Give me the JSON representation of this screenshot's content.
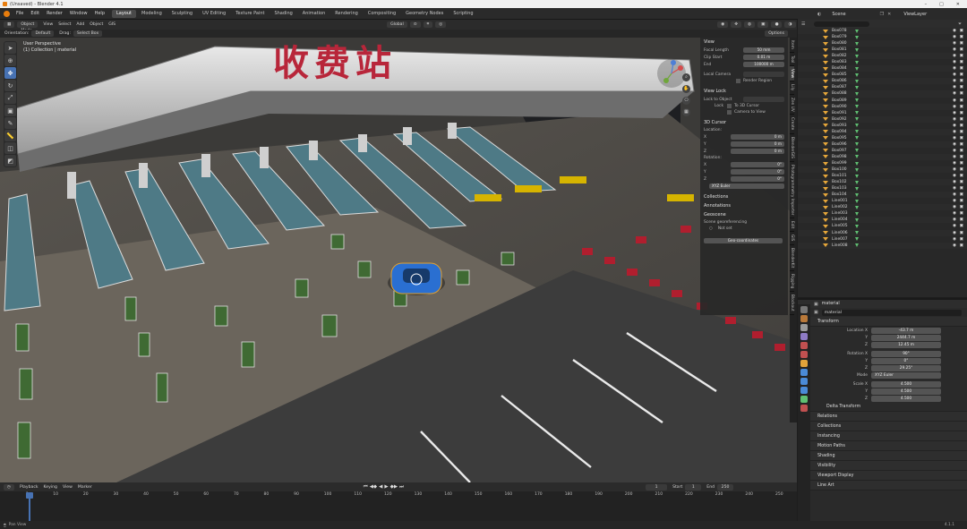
{
  "window": {
    "title": "(Unsaved) - Blender 4.1",
    "controls": [
      "–",
      "□",
      "✕"
    ]
  },
  "menubar": {
    "items": [
      "File",
      "Edit",
      "Render",
      "Window",
      "Help"
    ],
    "workspaces": [
      "Layout",
      "Modeling",
      "Sculpting",
      "UV Editing",
      "Texture Paint",
      "Shading",
      "Animation",
      "Rendering",
      "Compositing",
      "Geometry Nodes",
      "Scripting"
    ],
    "active_workspace": "Layout",
    "scene_label": "Scene",
    "viewlayer_label": "ViewLayer"
  },
  "viewport_header": {
    "mode": "Object Mode",
    "menus": [
      "View",
      "Select",
      "Add",
      "Object",
      "GIS"
    ],
    "transform": "Global",
    "options": "Options",
    "orientation_label": "Orientation:",
    "orientation_value": "Default",
    "drag_label": "Drag:",
    "drag_value": "Select Box"
  },
  "viewport": {
    "perspective": "User Perspective",
    "collection": "(1) Collection | material",
    "sign_text": "收费站"
  },
  "npanel": {
    "view_title": "View",
    "focal_length_label": "Focal Length",
    "focal_length": "50 mm",
    "clip_start_label": "Clip Start",
    "clip_start": "0.01 m",
    "clip_end_label": "End",
    "clip_end": "100000 m",
    "local_camera_label": "Local Camera",
    "render_region_label": "Render Region",
    "view_lock_title": "View Lock",
    "lock_to_object_label": "Lock to Object",
    "lock_label": "Lock",
    "to_3d_cursor_label": "To 3D Cursor",
    "camera_to_view_label": "Camera to View",
    "cursor_title": "3D Cursor",
    "location_label": "Location:",
    "rotation_label": "Rotation:",
    "axes": [
      "X",
      "Y",
      "Z"
    ],
    "loc_values": [
      "0 m",
      "0 m",
      "0 m"
    ],
    "rot_values": [
      "0°",
      "0°",
      "0°"
    ],
    "rotation_mode": "XYZ Euler",
    "collections_title": "Collections",
    "annotations_title": "Annotations",
    "georef_title": "Geoscene",
    "georef_label": "Scene georeferencing",
    "georef_crs": "Not set",
    "geo_coords_btn": "Geo-coordinates",
    "tabs": [
      "Item",
      "Tool",
      "View",
      "Lily",
      "Zen UV",
      "Create",
      "BlenderGIS",
      "Photogrammetry Importer",
      "Edit",
      "GIS",
      "BlenderKit",
      "Rigging",
      "Blockout"
    ]
  },
  "outliner": {
    "search_placeholder": "",
    "items": [
      "Box078",
      "Box079",
      "Box080",
      "Box081",
      "Box082",
      "Box083",
      "Box084",
      "Box085",
      "Box086",
      "Box087",
      "Box088",
      "Box089",
      "Box090",
      "Box091",
      "Box092",
      "Box093",
      "Box094",
      "Box095",
      "Box096",
      "Box097",
      "Box098",
      "Box099",
      "Box100",
      "Box101",
      "Box102",
      "Box103",
      "Box104",
      "Line001",
      "Line002",
      "Line003",
      "Line004",
      "Line005",
      "Line006",
      "Line007",
      "Line008"
    ]
  },
  "properties": {
    "object_name": "material",
    "data_name": "material",
    "transform_title": "Transform",
    "location_label": "Location X",
    "location": [
      "-43.7 m",
      "2444.7 m",
      "12.45 m"
    ],
    "rotation_label": "Rotation X",
    "rotation": [
      "90°",
      "0°",
      "29.25°"
    ],
    "mode_label": "Mode",
    "mode": "XYZ Euler",
    "scale_label": "Scale X",
    "scale": [
      "4.500",
      "4.500",
      "4.500"
    ],
    "axis_labels": [
      "Y",
      "Z"
    ],
    "sections": [
      "Delta Transform",
      "Relations",
      "Collections",
      "Instancing",
      "Motion Paths",
      "Shading",
      "Visibility",
      "Viewport Display",
      "Line Art"
    ]
  },
  "timeline": {
    "menus": [
      "Playback",
      "Keying",
      "View",
      "Marker"
    ],
    "current_frame": "1",
    "start_label": "Start",
    "start": "1",
    "end_label": "End",
    "end": "250",
    "ticks": [
      "1",
      "10",
      "20",
      "30",
      "40",
      "50",
      "60",
      "70",
      "80",
      "90",
      "100",
      "110",
      "120",
      "130",
      "140",
      "150",
      "160",
      "170",
      "180",
      "190",
      "200",
      "210",
      "220",
      "230",
      "240",
      "250"
    ]
  },
  "statusbar": {
    "left": "Pan View",
    "right": "4.1.1"
  },
  "colors": {
    "accent": "#4772b3",
    "outliner_icon": "#e5a63a",
    "mesh_icon": "#5fbf72",
    "sign_text": "#b8263a"
  }
}
